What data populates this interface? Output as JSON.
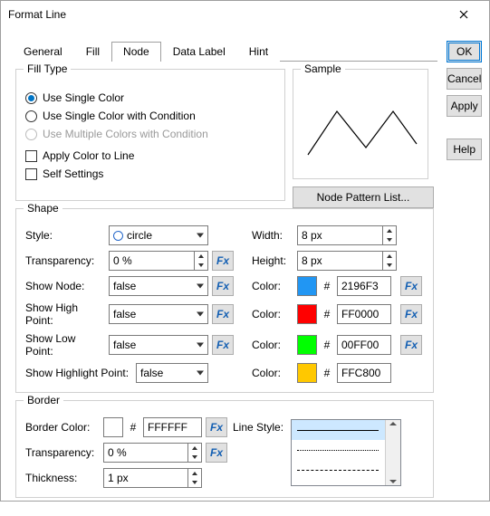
{
  "window": {
    "title": "Format Line"
  },
  "buttons": {
    "ok": "OK",
    "cancel": "Cancel",
    "apply": "Apply",
    "help": "Help"
  },
  "tabs": {
    "general": "General",
    "fill": "Fill",
    "node": "Node",
    "data_label": "Data Label",
    "hint": "Hint"
  },
  "fill_type": {
    "legend": "Fill Type",
    "opt_single": "Use Single Color",
    "opt_single_cond": "Use Single Color with Condition",
    "opt_multi_cond": "Use Multiple Colors with Condition",
    "apply_line": "Apply Color to Line",
    "self_settings": "Self Settings"
  },
  "sample": {
    "legend": "Sample",
    "node_pattern_btn": "Node Pattern List..."
  },
  "shape": {
    "legend": "Shape",
    "style_label": "Style:",
    "style_value": "circle",
    "trans_label": "Transparency:",
    "trans_value": "0 %",
    "show_node_label": "Show Node:",
    "show_node_value": "false",
    "show_hp_label": "Show High Point:",
    "show_hp_value": "false",
    "show_lp_label": "Show Low Point:",
    "show_lp_value": "false",
    "show_hl_label": "Show Highlight Point:",
    "show_hl_value": "false",
    "width_label": "Width:",
    "width_value": "8 px",
    "height_label": "Height:",
    "height_value": "8 px",
    "color_label": "Color:",
    "node_color_hex": "2196F3",
    "hp_color_hex": "FF0000",
    "lp_color_hex": "00FF00",
    "hl_color_hex": "FFC800",
    "hash": "#",
    "fx": "Fx"
  },
  "border": {
    "legend": "Border",
    "color_label": "Border Color:",
    "color_hex": "FFFFFF",
    "trans_label": "Transparency:",
    "trans_value": "0 %",
    "thick_label": "Thickness:",
    "thick_value": "1 px",
    "linestyle_label": "Line Style:",
    "hash": "#",
    "fx": "Fx"
  },
  "colors": {
    "node": "#2196F3",
    "hp": "#FF0000",
    "lp": "#00FF00",
    "hl": "#FFC800",
    "border": "#FFFFFF"
  }
}
